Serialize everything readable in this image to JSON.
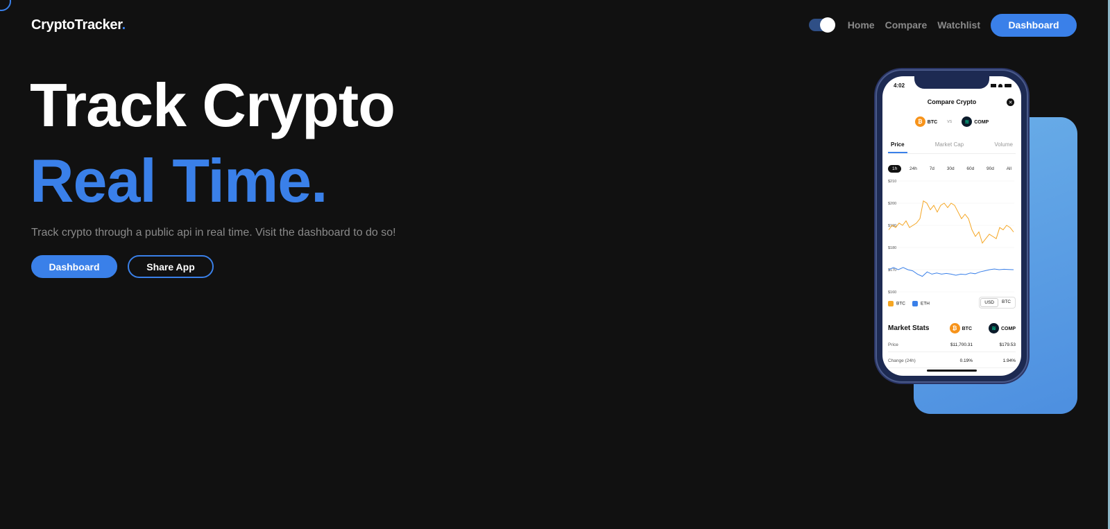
{
  "brand": {
    "name": "CryptoTracker",
    "dot": "."
  },
  "nav": {
    "links": [
      "Home",
      "Compare",
      "Watchlist"
    ],
    "dashboard_label": "Dashboard",
    "theme_toggle_on": true
  },
  "hero": {
    "line1": "Track Crypto",
    "line2": "Real Time.",
    "subtitle": "Track crypto through a public api in real time. Visit the dashboard to do so!",
    "primary_cta": "Dashboard",
    "secondary_cta": "Share App"
  },
  "phone": {
    "time": "4:02",
    "title": "Compare Crypto",
    "close": "✕",
    "coin_a": {
      "symbol": "BTC",
      "glyph": "₿"
    },
    "vs": "vs",
    "coin_b": {
      "symbol": "COMP",
      "glyph": "≋"
    },
    "tabs": [
      "Price",
      "Market Cap",
      "Volume"
    ],
    "active_tab": "Price",
    "ranges": [
      "1h",
      "24h",
      "7d",
      "30d",
      "60d",
      "90d",
      "All"
    ],
    "active_range": "1h",
    "legend": [
      "BTC",
      "ETH"
    ],
    "currency": [
      "USD",
      "BTC"
    ],
    "active_currency": "USD",
    "stats_title": "Market Stats",
    "stats": [
      {
        "label": "Price",
        "a": "$11,700.31",
        "b": "$179.53"
      },
      {
        "label": "Change (24h)",
        "a": "0.19%",
        "b": "1.94%"
      }
    ]
  },
  "chart_data": {
    "type": "line",
    "yticks": [
      "$210",
      "$200",
      "$190",
      "$180",
      "$170",
      "$160"
    ],
    "ylim": [
      160,
      210
    ],
    "series": [
      {
        "name": "BTC",
        "color": "#f5a623",
        "values": [
          188,
          190,
          189,
          191,
          190,
          192,
          189,
          190,
          191,
          193,
          201,
          200,
          197,
          199,
          196,
          199,
          200,
          198,
          200,
          199,
          196,
          193,
          195,
          193,
          188,
          185,
          187,
          182,
          184,
          186,
          185,
          184,
          189,
          188,
          190,
          189,
          187
        ]
      },
      {
        "name": "ETH",
        "color": "#3a80e9",
        "values": [
          170,
          171,
          170,
          171,
          170,
          169.5,
          168,
          167,
          169,
          168,
          168.5,
          168,
          168.3,
          168,
          167.5,
          168,
          167.8,
          168.5,
          168.2,
          169,
          169.5,
          170,
          170.3,
          170,
          170.2,
          170.1,
          170
        ]
      }
    ]
  }
}
